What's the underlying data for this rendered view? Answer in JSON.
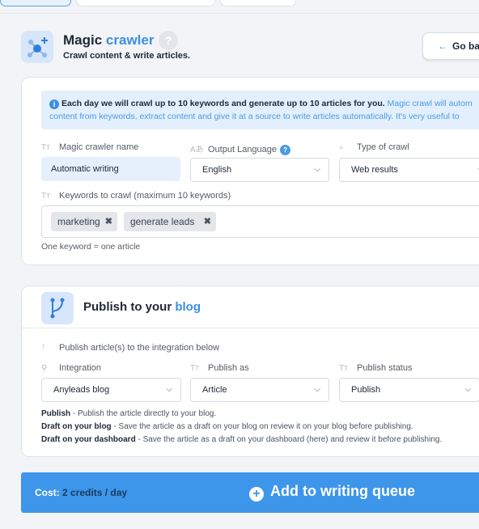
{
  "header": {
    "title_main": "Magic",
    "title_accent": "crawler",
    "help": "?",
    "subtitle": "Crawl content & write articles.",
    "go_back": "Go back"
  },
  "info": {
    "bold": "Each day we will crawl up to 10 keywords and generate up to 10 articles for you.",
    "rest1": " Magic crawl will autom",
    "line2": "content from keywords, extract content and give it at a source to write articles automatically. It's very useful to"
  },
  "form": {
    "name_label": "Magic crawler name",
    "name_value": "Automatic writing",
    "language_label": "Output Language",
    "language_help": "?",
    "language_value": "English",
    "crawl_type_label": "Type of crawl",
    "crawl_type_value": "Web results",
    "keywords_label": "Keywords to crawl (maximum 10 keywords)",
    "keywords": [
      "marketing",
      "generate leads"
    ],
    "keyword_hint": "One keyword = one article"
  },
  "publish": {
    "title_main": "Publish to your",
    "title_accent": "blog",
    "integration_hint": "Publish article(s) to the integration below",
    "integration_label": "Integration",
    "integration_value": "Anyleads blog",
    "publish_as_label": "Publish as",
    "publish_as_value": "Article",
    "status_label": "Publish status",
    "status_value": "Publish",
    "descriptions": [
      {
        "term": "Publish",
        "text": " - Publish the article directly to your blog."
      },
      {
        "term": "Draft on your blog",
        "text": " - Save the article as a draft on your blog on review it on your blog before publishing."
      },
      {
        "term": "Draft on your dashboard",
        "text": " - Save the article as a draft on your dashboard (here) and review it before publishing."
      }
    ]
  },
  "footer": {
    "cost_label": "Cost:",
    "cost_value": "2 credits / day",
    "queue_button": "Add to writing queue"
  },
  "colors": {
    "accent": "#3b90e0",
    "bar": "#3d96ea",
    "info_bg": "#e3effc"
  }
}
